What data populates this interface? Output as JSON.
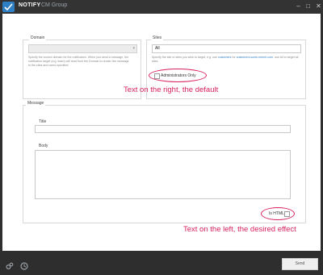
{
  "titlebar": {
    "app_name": "NOTIFY",
    "group_name": "CM Group",
    "minimize": "–",
    "maximize": "□",
    "close": "✕"
  },
  "domain": {
    "label": "Domain",
    "selected": "",
    "help": "Specify the source domain for the notification. When you send a message, the notification target (e.g. team) will read from the Domain to render the message to the sites and users specified."
  },
  "sites": {
    "label": "Sites",
    "value": "All",
    "help_prefix": "Specify the site or sites you wish to target, e.g. use ",
    "help_highlight_1": "customers",
    "help_mid": " for ",
    "help_highlight_2": "customers.some-merch.com",
    "help_suffix": ". use All to target all sites.",
    "admins_only_label": "Administrators Only"
  },
  "message": {
    "label": "Message",
    "title_label": "Title",
    "title_value": "",
    "body_label": "Body",
    "body_value": "",
    "is_html_label": "Is HTML"
  },
  "annotations": {
    "right": "Text on the right, the default",
    "left": "Text on the left, the desired effect"
  },
  "footer": {
    "send_label": "Send",
    "settings_icon": "gears-icon",
    "history_icon": "clock-icon"
  },
  "colors": {
    "accent": "#2f7fc4",
    "annotation": "#d6215e",
    "chrome": "#2e2e2e"
  }
}
